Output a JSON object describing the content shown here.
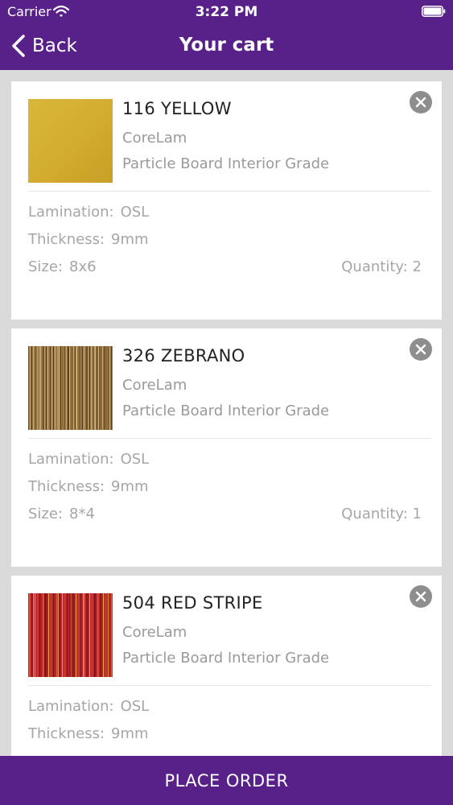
{
  "status_bar": {
    "carrier": "Carrier",
    "time": "3:22 PM"
  },
  "nav": {
    "back_label": "Back",
    "title": "Your cart"
  },
  "cart_items": [
    {
      "name": "116 YELLOW",
      "brand": "CoreLam",
      "grade": "Particle Board Interior Grade",
      "lamination_label": "Lamination:",
      "lamination": "OSL",
      "thickness_label": "Thickness:",
      "thickness": "9mm",
      "size_label": "Size:",
      "size": "8x6",
      "quantity_label": "Quantity:",
      "quantity": "2",
      "swatch": "solid-yellow"
    },
    {
      "name": "326 ZEBRANO",
      "brand": "CoreLam",
      "grade": "Particle Board Interior Grade",
      "lamination_label": "Lamination:",
      "lamination": "OSL",
      "thickness_label": "Thickness:",
      "thickness": "9mm",
      "size_label": "Size:",
      "size": "8*4",
      "quantity_label": "Quantity:",
      "quantity": "1",
      "swatch": "zebrano-wood"
    },
    {
      "name": "504 RED STRIPE",
      "brand": "CoreLam",
      "grade": "Particle Board Interior Grade",
      "lamination_label": "Lamination:",
      "lamination": "OSL",
      "thickness_label": "Thickness:",
      "thickness": "9mm",
      "swatch": "red-stripe"
    }
  ],
  "footer": {
    "place_order_label": "PLACE ORDER"
  },
  "colors": {
    "brand_purple": "#582189",
    "background": "#dadada",
    "close_button": "#8e8e8e"
  },
  "icons": [
    "wifi-icon",
    "battery-icon",
    "back-chevron-icon",
    "close-icon"
  ]
}
